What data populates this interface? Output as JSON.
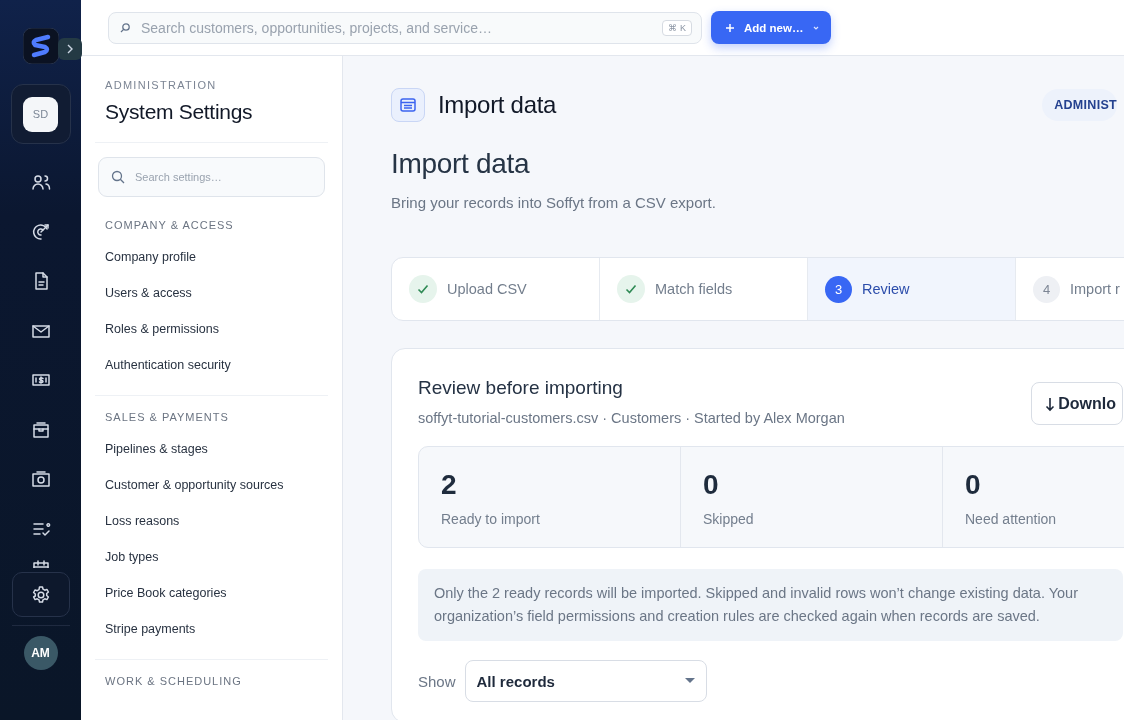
{
  "rail": {
    "workspace": "SD",
    "items": [
      {
        "selected": false
      },
      {
        "selected": false
      },
      {
        "selected": false
      },
      {
        "selected": false
      },
      {
        "selected": false
      },
      {
        "selected": false
      },
      {
        "selected": false
      },
      {
        "selected": false
      },
      {
        "selected": false
      }
    ],
    "settings_selected": true,
    "avatar": "AM"
  },
  "topbar": {
    "search": {
      "placeholder": "Search customers, opportunities, projects, and service…",
      "shortcut": "⌘ K"
    },
    "add_button": "Add new…"
  },
  "settings": {
    "eyebrow": "ADMINISTRATION",
    "title": "System Settings",
    "search_placeholder": "Search settings…",
    "sections": [
      {
        "heading": "COMPANY & ACCESS",
        "items": [
          "Company profile",
          "Users & access",
          "Roles & permissions",
          "Authentication security"
        ]
      },
      {
        "heading": "SALES & PAYMENTS",
        "items": [
          "Pipelines & stages",
          "Customer & opportunity sources",
          "Loss reasons",
          "Job types",
          "Price Book categories",
          "Stripe payments"
        ]
      },
      {
        "heading": "WORK & SCHEDULING"
      }
    ]
  },
  "main": {
    "header": {
      "title": "Import data",
      "badge": "ADMINIST"
    },
    "title": "Import data",
    "subtitle": "Bring your records into Soffyt from a CSV export.",
    "steps": [
      {
        "label": "Upload CSV",
        "done": true,
        "selected": false
      },
      {
        "label": "Match fields",
        "done": true,
        "selected": false
      },
      {
        "number": "3",
        "label": "Review",
        "done": false,
        "selected": true
      },
      {
        "number": "4",
        "label": "Import r",
        "done": false,
        "selected": false
      }
    ],
    "review": {
      "title": "Review before importing",
      "meta": "soffyt-tutorial-customers.csv · Customers · Started by Alex Morgan",
      "download_button": "Downlo",
      "stats": [
        {
          "value": "2",
          "label": "Ready to import"
        },
        {
          "value": "0",
          "label": "Skipped"
        },
        {
          "value": "0",
          "label": "Need attention"
        }
      ],
      "note": "Only the 2 ready records will be imported. Skipped and invalid rows won’t change existing data. Your organization’s field permissions and creation rules are checked again when records are saved.",
      "filter": {
        "label": "Show",
        "value": "All records"
      }
    }
  }
}
